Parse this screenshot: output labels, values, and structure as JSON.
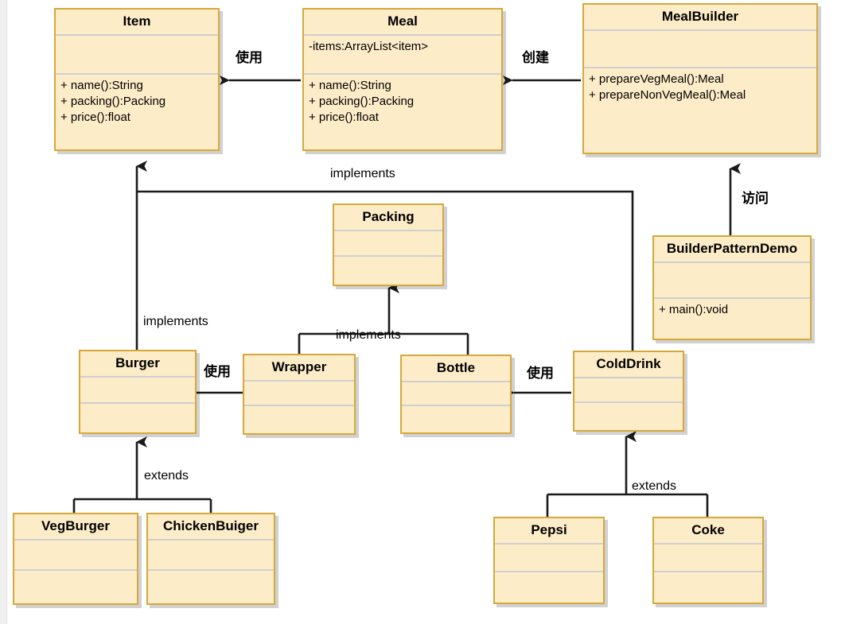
{
  "diagram": {
    "title": "Builder Pattern UML Class Diagram",
    "background": "#ffffff",
    "box_fill": "#fdecc8",
    "box_border": "#d6a83c",
    "divider": "#cfcfcf",
    "line_color": "#1a1a1a"
  },
  "classes": {
    "item": {
      "name": "Item",
      "attributes": [],
      "methods": [
        "+ name():String",
        "+ packing():Packing",
        "+ price():float"
      ]
    },
    "meal": {
      "name": "Meal",
      "attributes": [
        "-items:ArrayList<item>"
      ],
      "methods": [
        "+ name():String",
        "+ packing():Packing",
        "+ price():float"
      ]
    },
    "meal_builder": {
      "name": "MealBuilder",
      "attributes": [],
      "methods": [
        "+ prepareVegMeal():Meal",
        "+ prepareNonVegMeal():Meal"
      ]
    },
    "builder_pattern_demo": {
      "name": "BuilderPatternDemo",
      "attributes": [],
      "methods": [
        "+ main():void"
      ]
    },
    "packing": {
      "name": "Packing",
      "attributes": [],
      "methods": []
    },
    "burger": {
      "name": "Burger",
      "attributes": [],
      "methods": []
    },
    "wrapper": {
      "name": "Wrapper",
      "attributes": [],
      "methods": []
    },
    "bottle": {
      "name": "Bottle",
      "attributes": [],
      "methods": []
    },
    "cold_drink": {
      "name": "ColdDrink",
      "attributes": [],
      "methods": []
    },
    "veg_burger": {
      "name": "VegBurger",
      "attributes": [],
      "methods": []
    },
    "chicken_buiger": {
      "name": "ChickenBuiger",
      "attributes": [],
      "methods": []
    },
    "pepsi": {
      "name": "Pepsi",
      "attributes": [],
      "methods": []
    },
    "coke": {
      "name": "Coke",
      "attributes": [],
      "methods": []
    }
  },
  "relations": {
    "meal_uses_item": "使用",
    "mealbuilder_creates_meal": "创建",
    "demo_visits_mealbuilder": "访问",
    "colddrink_implements_item": "implements",
    "burger_implements_item": "implements",
    "packing_implements_top": "implements",
    "wrapper_bottle_implements_packing": "implements",
    "burger_uses_wrapper": "使用",
    "colddrink_uses_bottle": "使用",
    "burger_extends": "extends",
    "colddrink_extends": "extends"
  }
}
